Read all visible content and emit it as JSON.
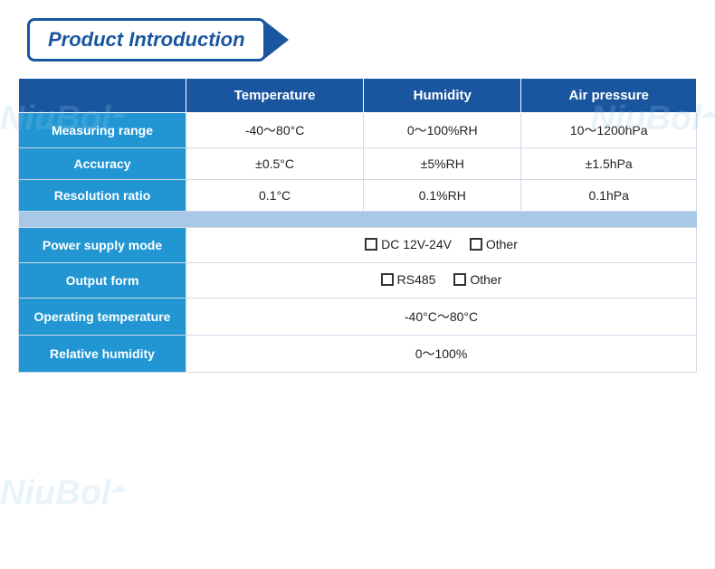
{
  "title": "Product Introduction",
  "watermarks": [
    "NiuBol",
    "NiuBol",
    "NiuBol"
  ],
  "table": {
    "headers": [
      "",
      "Temperature",
      "Humidity",
      "Air pressure"
    ],
    "rows": [
      {
        "label": "Measuring range",
        "temp": "-40～80°C",
        "humidity": "0～100%RH",
        "pressure": "10～1200hPa"
      },
      {
        "label": "Accuracy",
        "temp": "±0.5°C",
        "humidity": "±5%RH",
        "pressure": "±1.5hPa"
      },
      {
        "label": "Resolution ratio",
        "temp": "0.1°C",
        "humidity": "0.1%RH",
        "pressure": "0.1hPa"
      }
    ],
    "info_rows": [
      {
        "label": "Power supply mode",
        "value": "DC 12V-24V",
        "has_other": true
      },
      {
        "label": "Output form",
        "value": "RS485",
        "has_other": true
      },
      {
        "label": "Operating temperature",
        "value": "-40°C～80°C",
        "has_other": false
      },
      {
        "label": "Relative humidity",
        "value": "0～100%",
        "has_other": false
      }
    ]
  },
  "labels": {
    "other": "Other"
  }
}
